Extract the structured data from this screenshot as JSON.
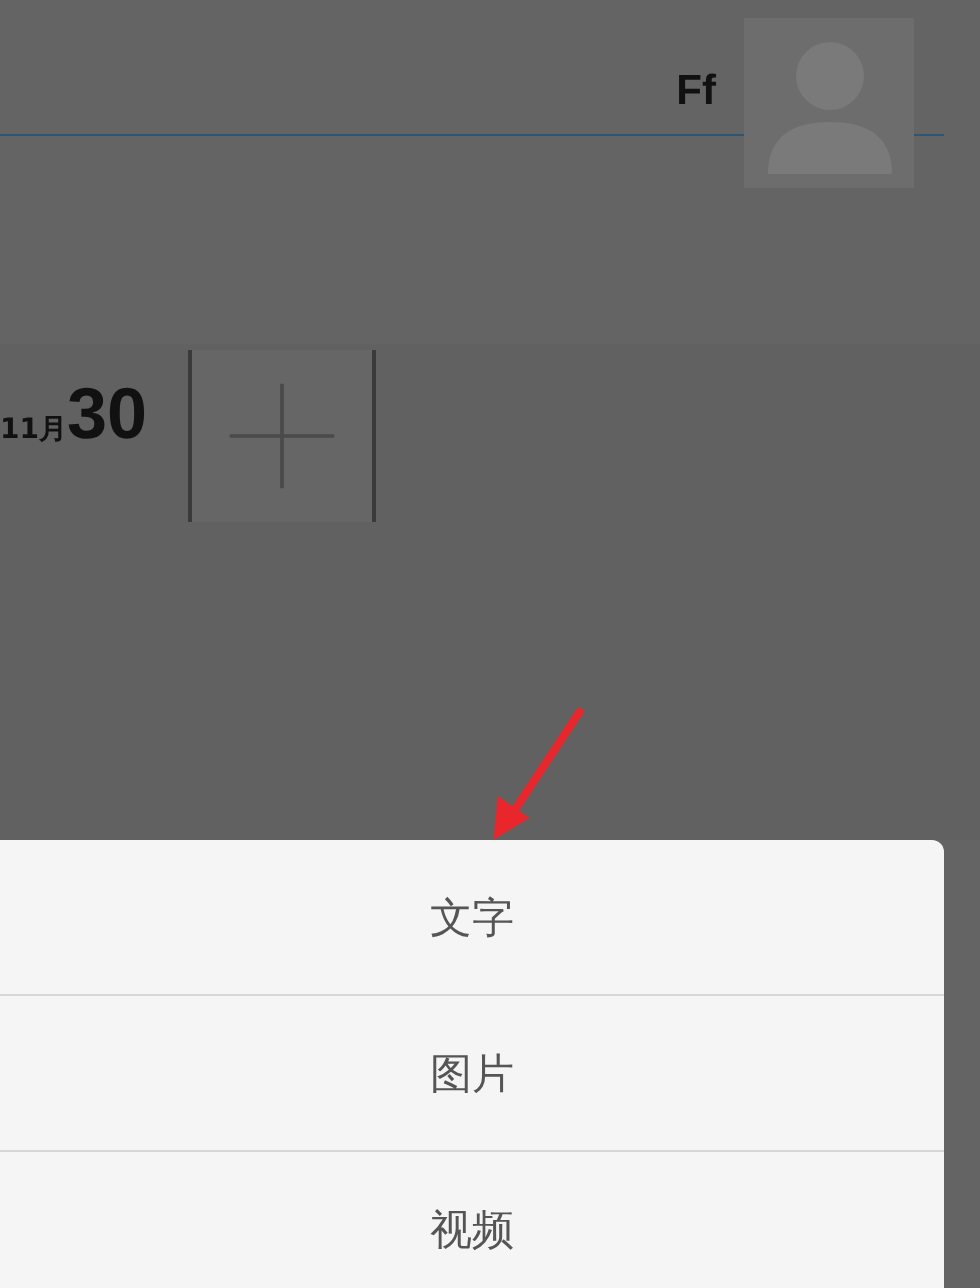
{
  "header": {
    "user_name": "Ff"
  },
  "date": {
    "month": "11月",
    "day": "30"
  },
  "action_sheet": {
    "options": [
      {
        "label": "文字"
      },
      {
        "label": "图片"
      },
      {
        "label": "视频"
      }
    ]
  }
}
